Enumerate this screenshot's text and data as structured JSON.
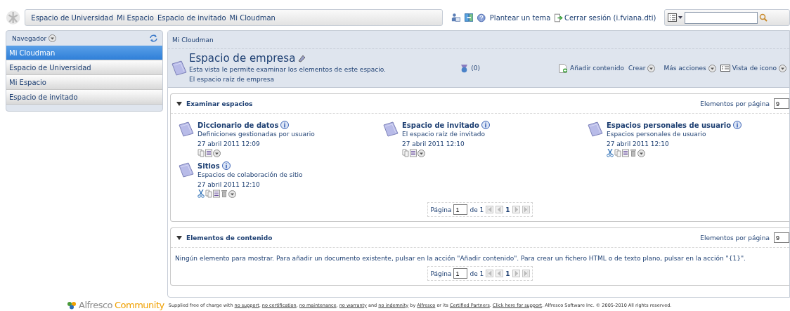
{
  "top_bar": {
    "breadcrumbs": [
      "Espacio de Universidad",
      "Mi Espacio",
      "Espacio de invitado",
      "Mi Cloudman"
    ],
    "help_link": "Plantear un tema",
    "logout_link": "Cerrar sesión (i.fviana.dti)"
  },
  "navigator": {
    "title": "Navegador",
    "items": [
      {
        "label": "Mi Cloudman",
        "selected": true
      },
      {
        "label": "Espacio de Universidad",
        "selected": false
      },
      {
        "label": "Mi Espacio",
        "selected": false
      },
      {
        "label": "Espacio de invitado",
        "selected": false
      }
    ]
  },
  "breadcrumb": "Mi Cloudman",
  "space": {
    "title": "Espacio de empresa",
    "description": "Esta vista le permite examinar los elementos de este espacio.",
    "subtitle": "El espacio raíz de empresa",
    "rules_count": "(0)",
    "actions": [
      {
        "label": "Añadir contenido",
        "kind": "add"
      },
      {
        "label": "Crear",
        "kind": "menu"
      },
      {
        "label": "Más acciones",
        "kind": "menu"
      },
      {
        "label": "Vista de icono",
        "kind": "view"
      }
    ]
  },
  "browse_spaces": {
    "title": "Examinar espacios",
    "expanded": true,
    "per_page_label": "Elementos por página",
    "per_page": "9",
    "items": [
      {
        "name": "Diccionario de datos",
        "description": "Definiciones gestionadas por usuario",
        "date": "27 abril 2011 12:09",
        "actions": [
          {
            "kind": "copy"
          },
          {
            "kind": "details"
          },
          {
            "kind": "more"
          }
        ]
      },
      {
        "name": "Espacio de invitado",
        "description": "El espacio raíz de invitado",
        "date": "27 abril 2011 12:10",
        "actions": [
          {
            "kind": "copy"
          },
          {
            "kind": "details"
          },
          {
            "kind": "more"
          }
        ]
      },
      {
        "name": "Espacios personales de usuario",
        "description": "Espacios personales de usuario",
        "date": "27 abril 2011 12:10",
        "actions": [
          {
            "kind": "cut"
          },
          {
            "kind": "copy"
          },
          {
            "kind": "details"
          },
          {
            "kind": "delete"
          },
          {
            "kind": "more"
          }
        ]
      },
      {
        "name": "Sitios",
        "description": "Espacios de colaboración de sitio",
        "date": "27 abril 2011 12:10",
        "actions": [
          {
            "kind": "cut"
          },
          {
            "kind": "copy"
          },
          {
            "kind": "details"
          },
          {
            "kind": "delete"
          },
          {
            "kind": "more"
          }
        ]
      }
    ],
    "pager": {
      "label": "Página",
      "page": "1",
      "of": "de 1",
      "current": "1"
    }
  },
  "content_items": {
    "title": "Elementos de contenido",
    "expanded": true,
    "per_page_label": "Elementos por página",
    "per_page": "9",
    "empty_message": "Ningún elemento para mostrar. Para añadir un documento existente, pulsar en la acción \"Añadir contenido\". Para crear un fichero HTML o de texto plano, pulsar en la acción \"{1}\".",
    "pager": {
      "label": "Página",
      "page": "1",
      "of": "de 1",
      "current": "1"
    }
  },
  "footer": {
    "brand": "Alfresco",
    "edition": "Community",
    "parts": [
      {
        "text": "Supplied free of charge with ",
        "link": false
      },
      {
        "text": "no support",
        "link": true
      },
      {
        "text": ", ",
        "link": false
      },
      {
        "text": "no certification",
        "link": true
      },
      {
        "text": ", ",
        "link": false
      },
      {
        "text": "no maintenance",
        "link": true
      },
      {
        "text": ", ",
        "link": false
      },
      {
        "text": "no warranty",
        "link": true
      },
      {
        "text": " and ",
        "link": false
      },
      {
        "text": "no indemnity",
        "link": true
      },
      {
        "text": " by ",
        "link": false
      },
      {
        "text": "Alfresco",
        "link": true
      },
      {
        "text": " or its ",
        "link": false
      },
      {
        "text": "Certified Partners",
        "link": true
      },
      {
        "text": ". ",
        "link": false
      },
      {
        "text": "Click here for support",
        "link": true
      },
      {
        "text": ". Alfresco Software Inc. © 2005-2010 All rights reserved.",
        "link": false
      }
    ]
  }
}
